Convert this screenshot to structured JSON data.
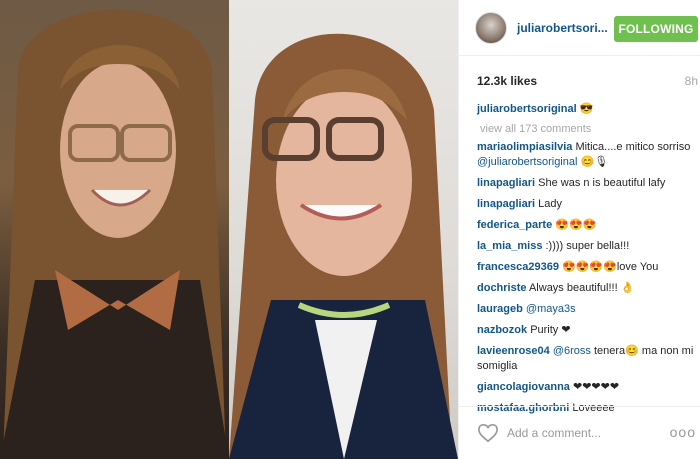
{
  "post": {
    "username": "juliarobertsori...",
    "follow_label": "FOLLOWING",
    "likes": "12.3k likes",
    "time": "8h",
    "caption_user": "juliarobertsoriginal",
    "caption_text": "😎",
    "view_all": "view all 173 comments",
    "add_comment_placeholder": "Add a comment...",
    "more_label": "ooo"
  },
  "comments": [
    {
      "user": "mariaolimpiasilvia",
      "pre": "Mitica....e mitico sorriso ",
      "mention": "@juliarobertsoriginal",
      "post": " 😊🎙"
    },
    {
      "user": "linapagliari",
      "pre": "She was n is beautiful lafy",
      "mention": "",
      "post": ""
    },
    {
      "user": "linapagliari",
      "pre": "Lady",
      "mention": "",
      "post": ""
    },
    {
      "user": "federica_parte",
      "pre": "😍😍😍",
      "mention": "",
      "post": ""
    },
    {
      "user": "la_mia_miss",
      "pre": ":)))) super bella!!!",
      "mention": "",
      "post": ""
    },
    {
      "user": "francesca29369",
      "pre": "😍😍😍😍love You",
      "mention": "",
      "post": ""
    },
    {
      "user": "dochriste",
      "pre": "Always beautiful!!! 👌",
      "mention": "",
      "post": ""
    },
    {
      "user": "laurageb",
      "pre": "",
      "mention": "@maya3s",
      "post": ""
    },
    {
      "user": "nazbozok",
      "pre": "Purity ❤",
      "mention": "",
      "post": ""
    },
    {
      "user": "lavieenrose04",
      "pre": "",
      "mention": "@6ross",
      "post": " tenera😊 ma non mi somiglia"
    },
    {
      "user": "giancolagiovanna",
      "pre": "❤❤❤❤❤",
      "mention": "",
      "post": ""
    },
    {
      "user": "mostafaa.ghorbni",
      "pre": "Loveeee",
      "mention": "",
      "post": ""
    }
  ],
  "colors": {
    "follow_green": "#70c050",
    "link_blue": "#125688",
    "muted_gray": "#a5a7aa"
  },
  "icons": {
    "heart": "heart-outline-icon",
    "more": "more-options-icon"
  }
}
